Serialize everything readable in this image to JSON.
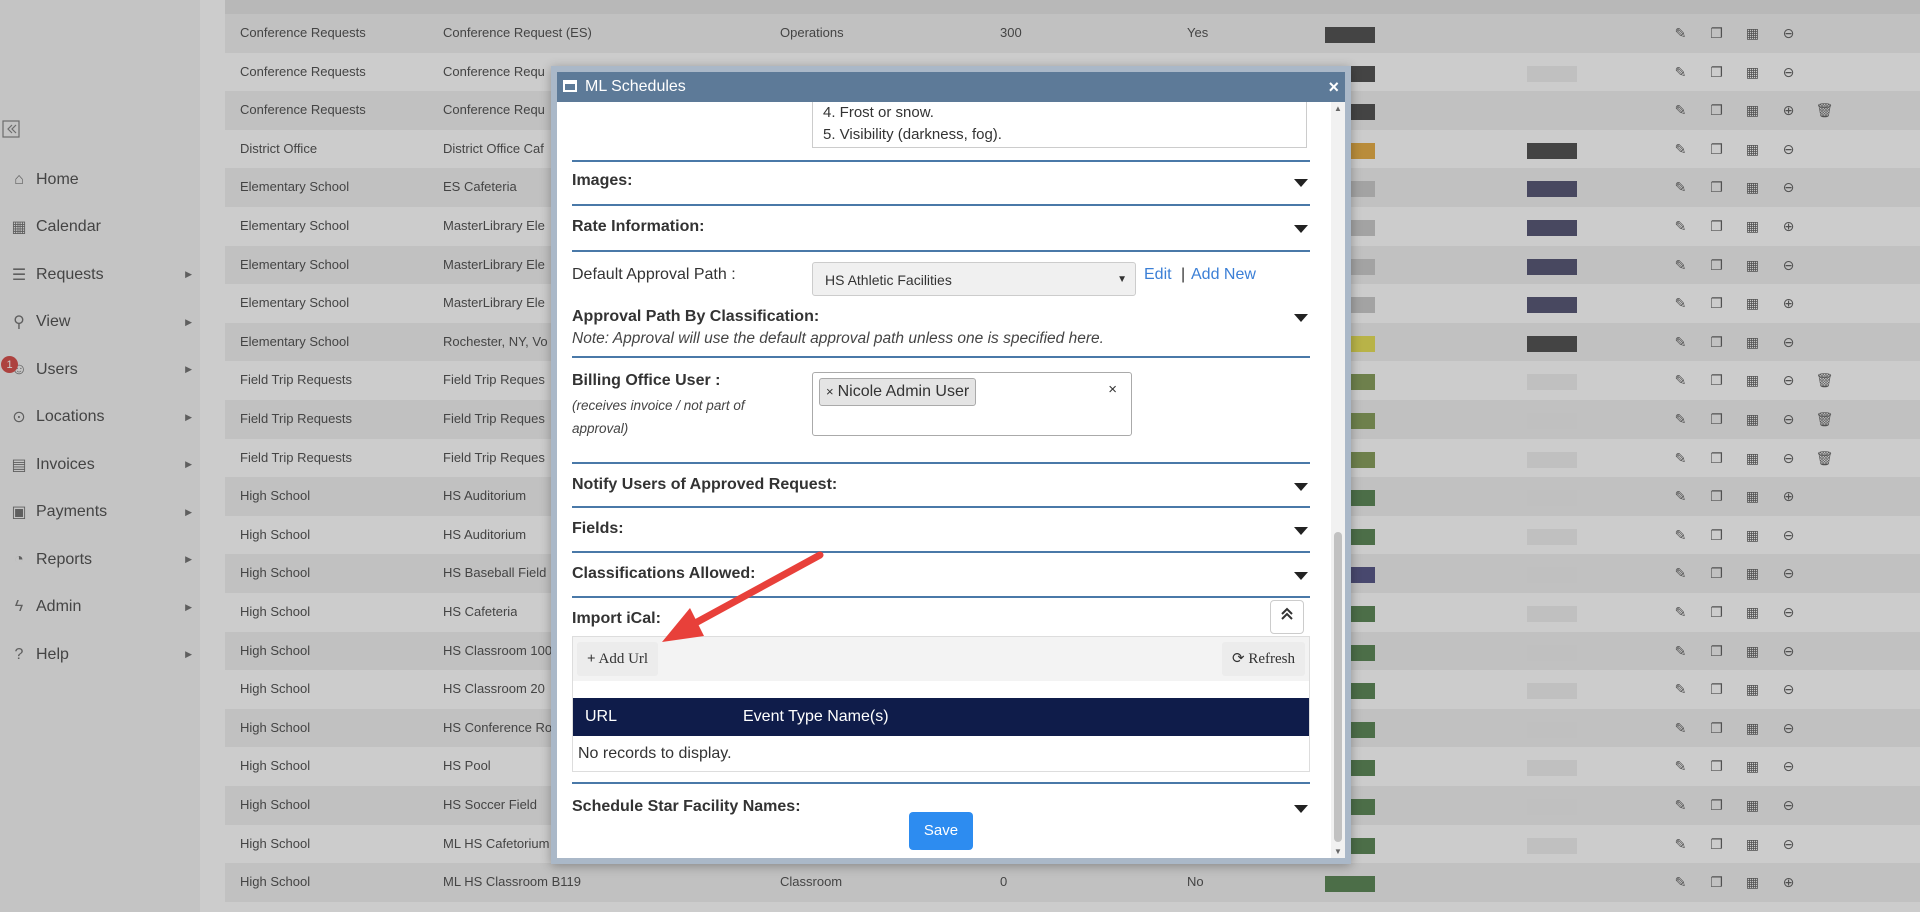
{
  "sidebar": {
    "collapse_icon": "«",
    "items": [
      {
        "label": "Home",
        "icon": "home-icon",
        "has_arrow": false
      },
      {
        "label": "Calendar",
        "icon": "calendar-icon",
        "has_arrow": false
      },
      {
        "label": "Requests",
        "icon": "requests-icon",
        "has_arrow": true
      },
      {
        "label": "View",
        "icon": "search-icon",
        "has_arrow": true
      },
      {
        "label": "Users",
        "icon": "users-icon",
        "has_arrow": true,
        "badge": "1"
      },
      {
        "label": "Locations",
        "icon": "location-pin-icon",
        "has_arrow": true
      },
      {
        "label": "Invoices",
        "icon": "invoice-icon",
        "has_arrow": true
      },
      {
        "label": "Payments",
        "icon": "payments-icon",
        "has_arrow": true
      },
      {
        "label": "Reports",
        "icon": "reports-icon",
        "has_arrow": true
      },
      {
        "label": "Admin",
        "icon": "bolt-icon",
        "has_arrow": true
      },
      {
        "label": "Help",
        "icon": "help-icon",
        "has_arrow": true
      }
    ]
  },
  "table": {
    "rows": [
      {
        "site": "Conference Requests",
        "space": "Conference Request (ES)",
        "type": "Operations",
        "occ": "300",
        "active": "Yes",
        "bg": "#555555",
        "text": "",
        "last": "minus"
      },
      {
        "site": "Conference Requests",
        "space": "Conference Requ",
        "type": "",
        "occ": "",
        "active": "",
        "bg": "#555555",
        "text": "#f0f0f0",
        "last": "minus"
      },
      {
        "site": "Conference Requests",
        "space": "Conference Requ",
        "type": "",
        "occ": "",
        "active": "",
        "bg": "#555555",
        "text": "",
        "last": "plus",
        "trash": true
      },
      {
        "site": "District Office",
        "space": "District Office Caf",
        "type": "",
        "occ": "",
        "active": "",
        "bg": "#e8b04a",
        "text": "#555555",
        "last": "minus"
      },
      {
        "site": "Elementary School",
        "space": "ES Cafeteria",
        "type": "",
        "occ": "",
        "active": "",
        "bg": "#cccccc",
        "text": "#5a5a78",
        "last": "minus"
      },
      {
        "site": "Elementary School",
        "space": "MasterLibrary Ele",
        "type": "",
        "occ": "",
        "active": "",
        "bg": "#cccccc",
        "text": "#5a5a78",
        "last": "plus"
      },
      {
        "site": "Elementary School",
        "space": "MasterLibrary Ele",
        "type": "",
        "occ": "",
        "active": "",
        "bg": "#cccccc",
        "text": "#5a5a78",
        "last": "minus"
      },
      {
        "site": "Elementary School",
        "space": "MasterLibrary Ele",
        "type": "",
        "occ": "",
        "active": "",
        "bg": "#cccccc",
        "text": "#5a5a78",
        "last": "plus"
      },
      {
        "site": "Elementary School",
        "space": "Rochester, NY, Vo",
        "type": "",
        "occ": "",
        "active": "",
        "bg": "#e6e05a",
        "text": "#555555",
        "last": "minus"
      },
      {
        "site": "Field Trip Requests",
        "space": "Field Trip Reques",
        "type": "",
        "occ": "",
        "active": "",
        "bg": "#8aa060",
        "text": "#f0f0f0",
        "last": "minus",
        "trash": true
      },
      {
        "site": "Field Trip Requests",
        "space": "Field Trip Reques",
        "type": "",
        "occ": "",
        "active": "",
        "bg": "#8aa060",
        "text": "#f0f0f0",
        "last": "minus",
        "trash": true
      },
      {
        "site": "Field Trip Requests",
        "space": "Field Trip Reques",
        "type": "",
        "occ": "",
        "active": "",
        "bg": "#8aa060",
        "text": "#f0f0f0",
        "last": "minus",
        "trash": true
      },
      {
        "site": "High School",
        "space": "HS Auditorium",
        "type": "",
        "occ": "",
        "active": "",
        "bg": "#5f8a5a",
        "text": "#f0f0f0",
        "last": "plus"
      },
      {
        "site": "High School",
        "space": "HS Auditorium",
        "type": "",
        "occ": "",
        "active": "",
        "bg": "#5f8a5a",
        "text": "#f0f0f0",
        "last": "minus"
      },
      {
        "site": "High School",
        "space": "HS Baseball Field",
        "type": "",
        "occ": "",
        "active": "",
        "bg": "#5a5a8a",
        "text": "#f0f0f0",
        "last": "minus"
      },
      {
        "site": "High School",
        "space": "HS Cafeteria",
        "type": "",
        "occ": "",
        "active": "",
        "bg": "#5f8a5a",
        "text": "#f0f0f0",
        "last": "minus"
      },
      {
        "site": "High School",
        "space": "HS Classroom 100",
        "type": "",
        "occ": "",
        "active": "",
        "bg": "#5f8a5a",
        "text": "#f0f0f0",
        "last": "minus"
      },
      {
        "site": "High School",
        "space": "HS Classroom 20",
        "type": "",
        "occ": "",
        "active": "",
        "bg": "#5f8a5a",
        "text": "#f0f0f0",
        "last": "minus"
      },
      {
        "site": "High School",
        "space": "HS Conference Ro",
        "type": "",
        "occ": "",
        "active": "",
        "bg": "#5f8a5a",
        "text": "#f0f0f0",
        "last": "minus"
      },
      {
        "site": "High School",
        "space": "HS Pool",
        "type": "",
        "occ": "",
        "active": "",
        "bg": "#5f8a5a",
        "text": "#f0f0f0",
        "last": "minus"
      },
      {
        "site": "High School",
        "space": "HS Soccer Field",
        "type": "",
        "occ": "",
        "active": "",
        "bg": "#5f8a5a",
        "text": "#f0f0f0",
        "last": "minus"
      },
      {
        "site": "High School",
        "space": "ML HS Cafetorium",
        "type": "",
        "occ": "",
        "active": "",
        "bg": "#5f8a5a",
        "text": "#f0f0f0",
        "last": "minus"
      },
      {
        "site": "High School",
        "space": "ML HS Classroom B119",
        "type": "Classroom",
        "occ": "0",
        "active": "No",
        "bg": "#5f8a5a",
        "text": "",
        "last": "plus"
      }
    ]
  },
  "modal": {
    "title": "ML Schedules",
    "close": "×",
    "textarea_lines": [
      "4. Frost or snow.",
      "5. Visibility (darkness, fog)."
    ],
    "sections": {
      "images": "Images:",
      "rate": "Rate Information:",
      "approval_class": "Approval Path By Classification:",
      "approval_note": "Note: Approval will use the default approval path unless one is specified here.",
      "notify": "Notify Users of Approved Request:",
      "fields": "Fields:",
      "classifications": "Classifications Allowed:",
      "import_ical": "Import iCal:",
      "schedule_star": "Schedule Star Facility Names:"
    },
    "default_approval": {
      "label": "Default Approval Path :",
      "value": "HS Athletic Facilities",
      "edit": "Edit",
      "separator": "|",
      "add_new": "Add New"
    },
    "billing": {
      "label": "Billing Office User :",
      "note": "(receives invoice / not part of approval)",
      "tag": "Nicole Admin User",
      "tag_remove": "×",
      "clear": "×"
    },
    "ical": {
      "add_url": "Add Url",
      "refresh": "Refresh",
      "col_url": "URL",
      "col_event": "Event Type Name(s)",
      "empty": "No records to display."
    },
    "save": "Save"
  },
  "colors": {
    "header": "#5d7a98",
    "accent": "#4a79a8",
    "grid_header": "#0f1c4a",
    "save": "#2d8cf0",
    "link": "#3b7fd6",
    "annotation_arrow": "#e8403a"
  }
}
